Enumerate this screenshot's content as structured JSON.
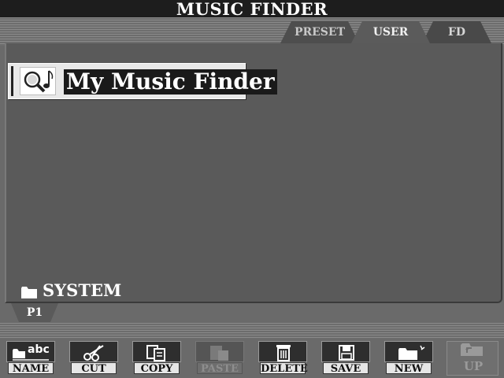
{
  "window": {
    "title": "MUSIC FINDER"
  },
  "tabs": [
    {
      "label": "PRESET",
      "active": false
    },
    {
      "label": "USER",
      "active": true
    },
    {
      "label": "FD",
      "active": false
    }
  ],
  "file_list": {
    "selected_item": {
      "name": "My Music Finder",
      "icon": "music-finder-file-icon"
    },
    "folder": {
      "name": "SYSTEM",
      "icon": "folder-icon"
    }
  },
  "page": {
    "label": "P1"
  },
  "toolbar": {
    "name_label": "NAME",
    "cut_label": "CUT",
    "copy_label": "COPY",
    "paste_label": "PASTE",
    "delete_label": "DELETE",
    "save_label": "SAVE",
    "new_label": "NEW",
    "up_label": "UP",
    "name_icon_text": "abc",
    "paste_enabled": false,
    "up_enabled": false
  },
  "colors": {
    "background": "#6a6a6a",
    "panel": "#5a5a5a",
    "title_bar": "#1d1d1d",
    "selection": "#1a1a1a"
  }
}
